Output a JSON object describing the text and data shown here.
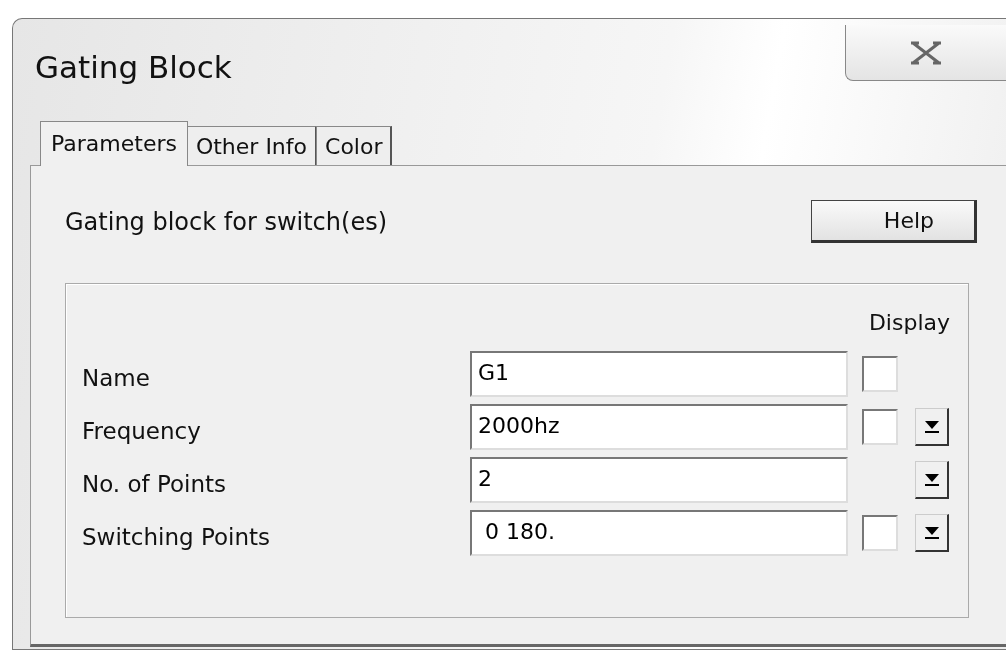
{
  "window": {
    "title": "Gating Block"
  },
  "tabs": [
    {
      "label": "Parameters",
      "selected": true
    },
    {
      "label": "Other Info",
      "selected": false
    },
    {
      "label": "Color",
      "selected": false
    }
  ],
  "description": "Gating block for switch(es)",
  "help_button": "Help",
  "display_heading": "Display",
  "rows": [
    {
      "label": "Name",
      "value": "G1",
      "display_checkbox": {
        "checked": false
      },
      "dropdown": false
    },
    {
      "label": "Frequency",
      "value": "2000hz",
      "display_checkbox": {
        "checked": false
      },
      "dropdown": true
    },
    {
      "label": "No. of Points",
      "value": "2",
      "dropdown": true
    },
    {
      "label": "Switching Points",
      "value": " 0 180.",
      "display_checkbox": {
        "checked": false
      },
      "dropdown": true
    }
  ]
}
